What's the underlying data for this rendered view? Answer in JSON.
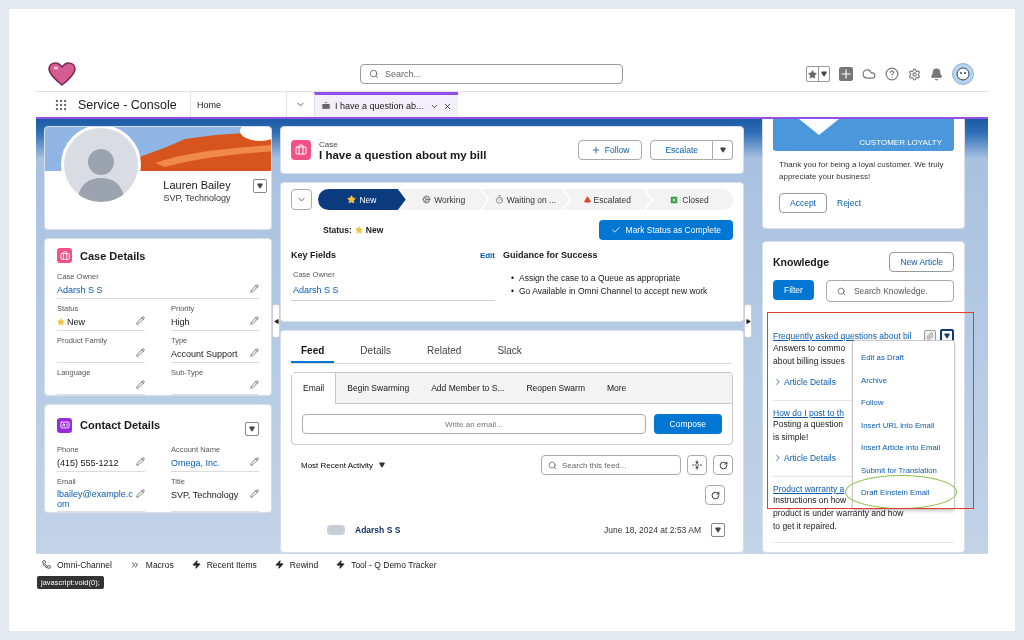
{
  "header": {
    "search": {
      "placeholder": "Search..."
    }
  },
  "nav": {
    "app_name": "Service - Console",
    "tabs": [
      {
        "label": "Home",
        "selected": false,
        "kind": "home"
      },
      {
        "label": "I have a question ab...",
        "selected": true,
        "kind": "case"
      }
    ]
  },
  "profile": {
    "name": "Lauren Bailey",
    "title": "SVP, Technology"
  },
  "case_details": {
    "title": "Case Details",
    "rows": [
      [
        {
          "label": "Case Owner",
          "value": "Adarsh S S",
          "kind": "link"
        }
      ],
      [
        {
          "label": "Status",
          "value": "New",
          "kind": "status"
        },
        {
          "label": "Priority",
          "value": "High",
          "kind": "text"
        }
      ],
      [
        {
          "label": "Product Family",
          "kind": "text"
        },
        {
          "label": "Type",
          "value": "Account Support",
          "kind": "text"
        }
      ],
      [
        {
          "label": "Language",
          "kind": "text"
        },
        {
          "label": "Sub-Type",
          "kind": "text"
        }
      ]
    ]
  },
  "contact_details": {
    "title": "Contact Details",
    "rows": [
      [
        {
          "label": "Phone",
          "value": "(415) 555-1212",
          "kind": "text"
        },
        {
          "label": "Account Name",
          "value": "Omega, Inc.",
          "kind": "link"
        }
      ],
      [
        {
          "label": "Email",
          "value": "lbailey@example.com",
          "kind": "link"
        },
        {
          "label": "Title",
          "value": "SVP, Technology",
          "kind": "text"
        }
      ]
    ]
  },
  "case": {
    "object": "Case",
    "title": "I have a question about my bill",
    "follow": "Follow",
    "escalate": "Escalate"
  },
  "path": {
    "steps": [
      {
        "label": "New",
        "kind": "star",
        "selected": true
      },
      {
        "label": "Working",
        "kind": "gear",
        "selected": false
      },
      {
        "label": "Waiting on ...",
        "kind": "timer",
        "selected": false
      },
      {
        "label": "Escalated",
        "kind": "warning",
        "selected": false
      },
      {
        "label": "Closed",
        "kind": "closed",
        "selected": false
      }
    ],
    "status_label": "Status:",
    "status_value": "New",
    "complete_button": "Mark Status as Complete"
  },
  "key_fields": {
    "title": "Key Fields",
    "edit": "Edit",
    "label": "Case Owner",
    "value": "Adarsh S S"
  },
  "guidance": {
    "title": "Guidance for Success",
    "bullet": "•",
    "items": [
      "Assign the case to a Queue as appropriate",
      "Go Available in Omni Channel to accept new work"
    ]
  },
  "feed": {
    "tabs": [
      {
        "label": "Feed",
        "selected": true
      },
      {
        "label": "Details",
        "selected": false
      },
      {
        "label": "Related",
        "selected": false
      },
      {
        "label": "Slack",
        "selected": false
      }
    ],
    "actions": [
      {
        "label": "Email",
        "selected": true
      },
      {
        "label": "Begin Swarming",
        "selected": false
      },
      {
        "label": "Add Member to S...",
        "selected": false
      },
      {
        "label": "Reopen Swarm",
        "selected": false
      },
      {
        "label": "More",
        "selected": false
      }
    ],
    "email": {
      "placeholder": "Write an email..."
    },
    "compose": "Compose",
    "sort": "Most Recent Activity",
    "search": {
      "placeholder": "Search this feed..."
    },
    "post": {
      "author": "Adarsh S S",
      "time": "June 18, 2024 at 2:53 AM"
    }
  },
  "loyalty": {
    "banner": "CUSTOMER LOYALTY",
    "message": "Thank you for being a loyal customer. We truly appreciate your business!",
    "accept": "Accept",
    "reject": "Reject"
  },
  "knowledge": {
    "title": "Knowledge",
    "new_article": "New Article",
    "filter": "Filter",
    "search": {
      "placeholder": "Search Knowledge."
    },
    "outlined": true,
    "articles": [
      {
        "title": "Frequently asked questions about bil",
        "summary_lines": [
          "Answers to commo",
          "about billing issues"
        ],
        "details": "Article Details"
      },
      {
        "title": "How do I post to th",
        "summary_lines": [
          "Posting a question",
          "is simple!"
        ],
        "details": "Article Details"
      },
      {
        "title": "Product warranty a",
        "summary_lines": [
          "Instructions on how",
          "product is under warranty and how",
          "to get it repaired."
        ]
      }
    ],
    "menu_open": true,
    "menu": [
      {
        "label": "Edit as Draft",
        "circled": false
      },
      {
        "label": "Archive",
        "circled": false
      },
      {
        "label": "Follow",
        "circled": false
      },
      {
        "label": "Insert URL into Email",
        "circled": false
      },
      {
        "label": "Insert Article into Email",
        "circled": false
      },
      {
        "label": "Submit for Translation",
        "circled": false
      },
      {
        "label": "Draft Einstein Email",
        "circled": true
      }
    ]
  },
  "utility_bar": {
    "items": [
      {
        "label": "Omni-Channel",
        "kind": "phone"
      },
      {
        "label": "Macros",
        "kind": "macros"
      },
      {
        "label": "Recent Items",
        "kind": "bolt"
      },
      {
        "label": "Rewind",
        "kind": "bolt"
      },
      {
        "label": "Tool - Q Demo Tracker",
        "kind": "bolt"
      }
    ],
    "tooltip": "javascript:void(0);"
  }
}
